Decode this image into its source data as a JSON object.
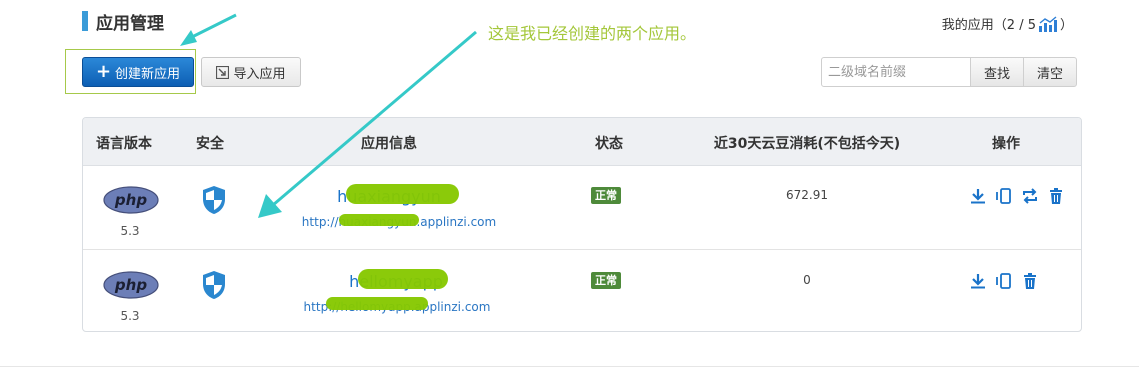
{
  "header": {
    "title": "应用管理",
    "my_apps_label": "我的应用（2 / 5",
    "my_apps_close": "）",
    "stats_icon": "bar-chart-icon"
  },
  "annotation": {
    "text": "这是我已经创建的两个应用。",
    "color": "#a4c73a"
  },
  "toolbar": {
    "create_label": "创建新应用",
    "import_label": "导入应用",
    "search_placeholder": "二级域名前缀",
    "search_value": "",
    "search_label": "查找",
    "clear_label": "清空"
  },
  "table": {
    "columns": [
      "语言版本",
      "安全",
      "应用信息",
      "状态",
      "近30天云豆消耗(不包括今天)",
      "操作"
    ],
    "rows": [
      {
        "language": "php",
        "version": "5.3",
        "app_name": "huaxiangyun",
        "url": "http://huaxiangyun.applinzi.com",
        "status": "正常",
        "cost": "672.91",
        "actions": [
          "download-icon",
          "mobile-icon",
          "transfer-icon",
          "delete-icon"
        ]
      },
      {
        "language": "php",
        "version": "5.3",
        "app_name": "hellomyapp",
        "url": "http://hellomyapp.applinzi.com",
        "status": "正常",
        "cost": "0",
        "actions": [
          "download-icon",
          "mobile-icon",
          "delete-icon"
        ]
      }
    ]
  },
  "colors": {
    "primary": "#0d5fb4",
    "link": "#2a76c3",
    "status_ok": "#4e8a3a",
    "arrow": "#35c9c8",
    "redaction": "#86c800"
  }
}
